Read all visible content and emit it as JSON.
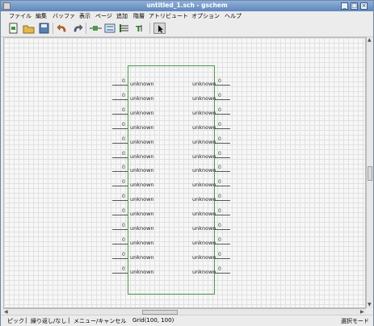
{
  "window": {
    "title": "untitled_1.sch - gschem"
  },
  "menu": [
    "ファイル",
    "編集",
    "バッファ",
    "表示",
    "ページ",
    "追加",
    "階層",
    "アトリビュート",
    "オプション",
    "ヘルプ"
  ],
  "toolbar": {
    "buttons": [
      "new-file-icon",
      "open-file-icon",
      "save-file-icon",
      "undo-icon",
      "redo-icon",
      "add-component-icon",
      "add-net-icon",
      "add-bus-icon",
      "add-text-icon",
      "select-pointer-icon"
    ]
  },
  "schematic": {
    "left_pins": {
      "numbers": [
        "0",
        "0",
        "0",
        "0",
        "0",
        "0",
        "0",
        "0",
        "0",
        "0",
        "0",
        "0",
        "0",
        "0"
      ],
      "labels": [
        "unknown",
        "unknown",
        "unknown",
        "unknown",
        "unknown",
        "unknown",
        "unknown",
        "unknown",
        "unknown",
        "unknown",
        "unknown",
        "unknown",
        "unknown",
        "unknown"
      ]
    },
    "right_pins": {
      "numbers": [
        "0",
        "0",
        "0",
        "0",
        "0",
        "0",
        "0",
        "0",
        "0",
        "0",
        "0",
        "0",
        "0",
        "0"
      ],
      "labels": [
        "unknown",
        "unknown",
        "unknown",
        "unknown",
        "unknown",
        "unknown",
        "unknown",
        "unknown",
        "unknown",
        "unknown",
        "unknown",
        "unknown",
        "unknown",
        "unknown"
      ]
    }
  },
  "status": {
    "left": "ピック",
    "middle": "繰り返し/なし",
    "right_action": "メニュー/キャンセル",
    "grid": "Grid(100, 100)",
    "mode": "選択モード"
  }
}
